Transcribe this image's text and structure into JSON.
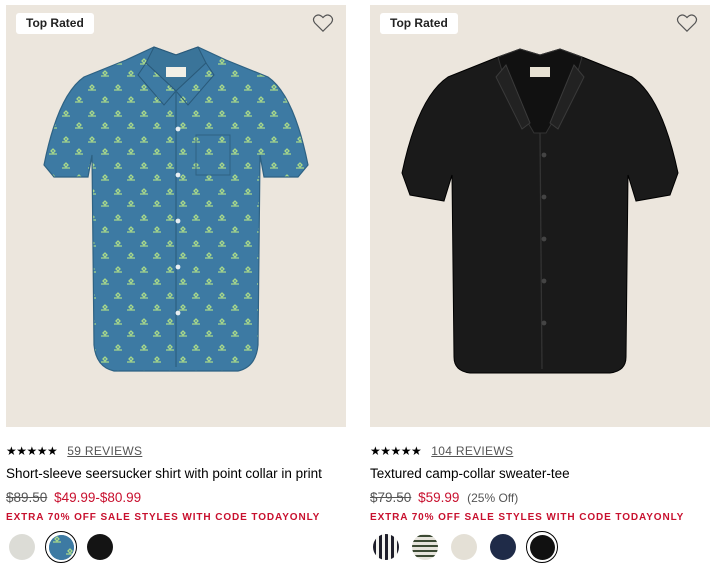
{
  "products": [
    {
      "badge": "Top Rated",
      "stars": "★★★★★",
      "reviews": "59 REVIEWS",
      "name": "Short-sleeve seersucker shirt with point collar in print",
      "price_was": "$89.50",
      "price_now": "$49.99-$80.99",
      "price_off": "",
      "promo": "EXTRA 70% OFF SALE STYLES WITH CODE TODAYONLY",
      "swatches": [
        {
          "color": "#dcdcd6",
          "label": "light-grey"
        },
        {
          "color": "#3f7ca3",
          "label": "blue-print",
          "selected": true
        },
        {
          "color": "#141414",
          "label": "black"
        }
      ]
    },
    {
      "badge": "Top Rated",
      "stars": "★★★★★",
      "reviews": "104 REVIEWS",
      "name": "Textured camp-collar sweater-tee",
      "price_was": "$79.50",
      "price_now": "$59.99",
      "price_off": "(25% Off)",
      "promo": "EXTRA 70% OFF SALE STYLES WITH CODE TODAYONLY",
      "swatches": [
        {
          "color": "#1e1e2a",
          "label": "black-white-stripe"
        },
        {
          "color": "#e6e4dc",
          "label": "cream-green-stripe"
        },
        {
          "color": "#e4e0d6",
          "label": "ivory"
        },
        {
          "color": "#1f2b48",
          "label": "navy"
        },
        {
          "color": "#111111",
          "label": "black",
          "selected": true
        }
      ]
    }
  ],
  "colors": {
    "sale_red": "#c8102e",
    "image_bg": "#ece6dd",
    "shirt_blue": "#3d7aa3",
    "shirt_black": "#1a1a1a"
  },
  "icons": [
    "heart-icon",
    "star-icon"
  ]
}
